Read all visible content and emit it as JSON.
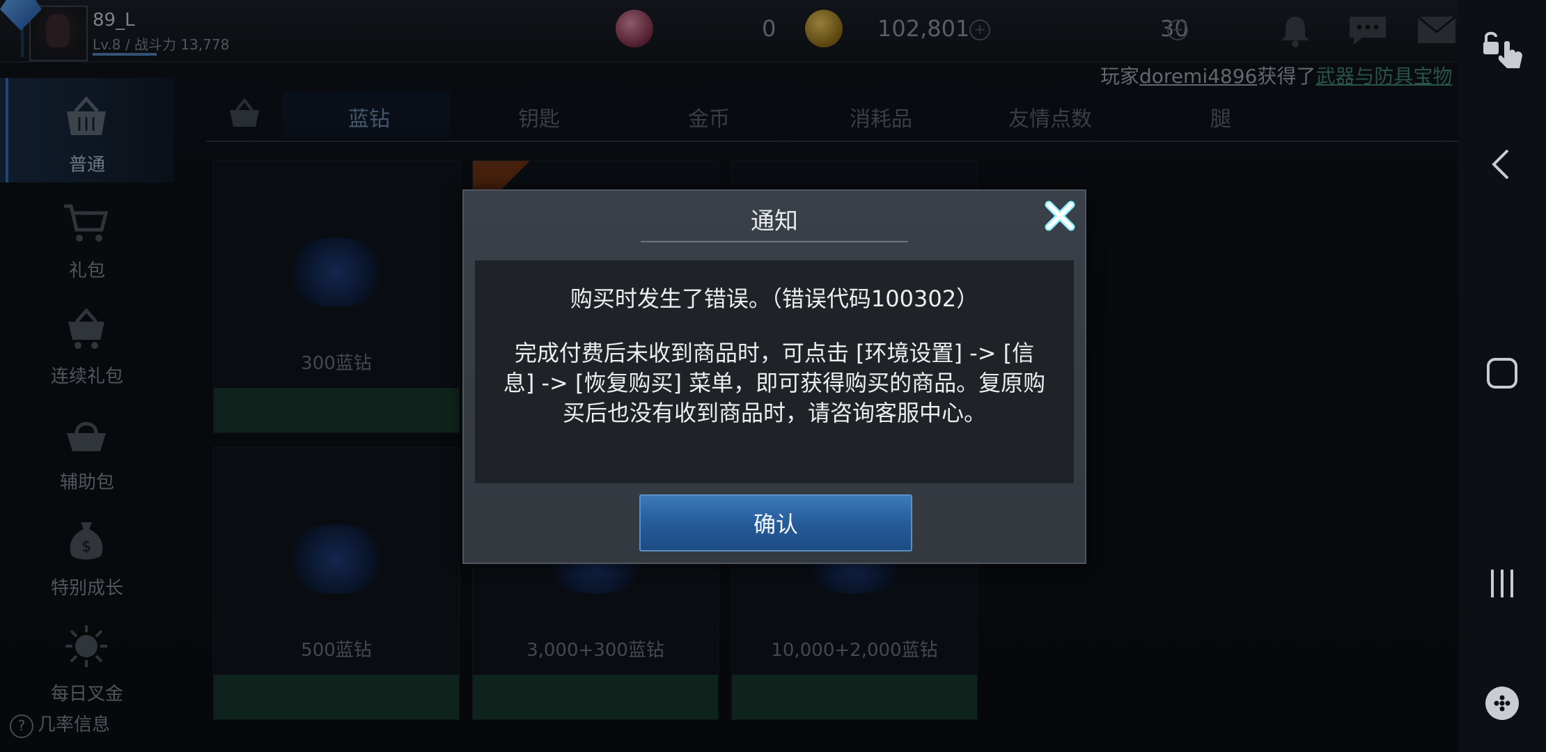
{
  "player": {
    "name": "89_L",
    "stats": "Lv.8 / 战斗力 13,778"
  },
  "currency": {
    "orb": "0",
    "gold": "102,801",
    "gems": "30",
    "plus": "+"
  },
  "ticker": {
    "prefix": "玩家",
    "user": "doremi4896",
    "middle": "获得了",
    "item": "武器与防具宝物"
  },
  "sidebar": {
    "items": [
      {
        "label": "普通",
        "icon": "basket-icon"
      },
      {
        "label": "礼包",
        "icon": "cart-icon"
      },
      {
        "label": "连续礼包",
        "icon": "cart-stack-icon"
      },
      {
        "label": "辅助包",
        "icon": "bundle-icon"
      },
      {
        "label": "特别成长",
        "icon": "money-bag-icon"
      },
      {
        "label": "每日叉金",
        "icon": "sun-coin-icon"
      }
    ],
    "probability_info": "几率信息",
    "probability_icon": "?"
  },
  "tabs": [
    "蓝钻",
    "钥匙",
    "金币",
    "消耗品",
    "友情点数",
    "腿"
  ],
  "cards": [
    {
      "name": "300蓝钻"
    },
    {
      "name": ""
    },
    {
      "name": ""
    },
    {
      "name": "500蓝钻"
    },
    {
      "name": "3,000+300蓝钻"
    },
    {
      "name": "10,000+2,000蓝钻"
    }
  ],
  "dialog": {
    "title": "通知",
    "message_1": "购买时发生了错误。（错误代码100302）",
    "message_2": "完成付费后未收到商品时，可点击 [环境设置] -> [信息] -> [恢复购买] 菜单，即可获得购买的商品。复原购买后也没有收到商品时，请咨询客服中心。",
    "confirm": "确认"
  },
  "colors": {
    "accent_blue": "#2f6fb0",
    "buy_green": "#16372a",
    "dialog_bg": "#3a4048"
  }
}
